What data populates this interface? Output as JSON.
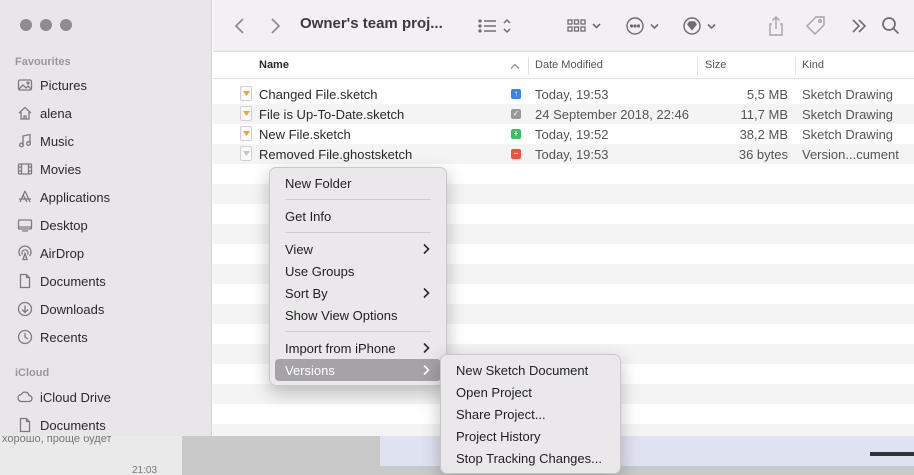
{
  "window": {
    "title": "Owner's team proj..."
  },
  "sidebar": {
    "favourites_label": "Favourites",
    "icloud_label": "iCloud",
    "items": [
      {
        "label": "Pictures",
        "icon": "pictures-icon"
      },
      {
        "label": "alena",
        "icon": "home-icon"
      },
      {
        "label": "Music",
        "icon": "music-icon"
      },
      {
        "label": "Movies",
        "icon": "movies-icon"
      },
      {
        "label": "Applications",
        "icon": "applications-icon"
      },
      {
        "label": "Desktop",
        "icon": "desktop-icon"
      },
      {
        "label": "AirDrop",
        "icon": "airdrop-icon"
      },
      {
        "label": "Documents",
        "icon": "document-icon"
      },
      {
        "label": "Downloads",
        "icon": "downloads-icon"
      },
      {
        "label": "Recents",
        "icon": "recents-icon"
      }
    ],
    "icloud_items": [
      {
        "label": "iCloud Drive",
        "icon": "cloud-icon"
      },
      {
        "label": "Documents",
        "icon": "document-icon"
      }
    ]
  },
  "columns": {
    "name": "Name",
    "date": "Date Modified",
    "size": "Size",
    "kind": "Kind"
  },
  "files": [
    {
      "name": "Changed File.sketch",
      "status": "changed",
      "status_color": "#3b82f0",
      "date": "Today, 19:53",
      "size": "5,5 MB",
      "kind": "Sketch Drawing"
    },
    {
      "name": "File is Up-To-Date.sketch",
      "status": "up-to-date",
      "status_color": "#9a989b",
      "date": "24 September 2018, 22:46",
      "size": "11,7 MB",
      "kind": "Sketch Drawing"
    },
    {
      "name": "New File.sketch",
      "status": "new",
      "status_color": "#3fbf5c",
      "date": "Today, 19:52",
      "size": "38,2 MB",
      "kind": "Sketch Drawing"
    },
    {
      "name": "Removed File.ghostsketch",
      "status": "removed",
      "status_color": "#ee5340",
      "date": "Today, 19:53",
      "size": "36 bytes",
      "kind": "Version...cument"
    }
  ],
  "context_menu": {
    "new_folder": "New Folder",
    "get_info": "Get Info",
    "view": "View",
    "use_groups": "Use Groups",
    "sort_by": "Sort By",
    "show_view_options": "Show View Options",
    "import_from_iphone": "Import from iPhone",
    "versions": "Versions"
  },
  "versions_menu": {
    "new_sketch_document": "New Sketch Document",
    "open_project": "Open Project",
    "share_project": "Share Project...",
    "project_history": "Project History",
    "stop_tracking": "Stop Tracking Changes..."
  },
  "background": {
    "partial_text": "хорошо, проще будет",
    "time": "21:03"
  }
}
